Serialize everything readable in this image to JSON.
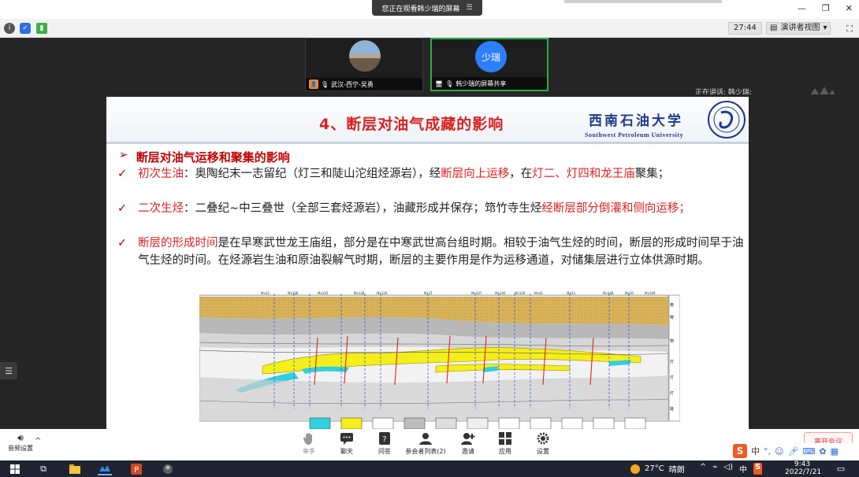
{
  "window": {
    "sharing_banner": "您正在观看韩少瑞的屏幕",
    "sharing_menu_icon": "menu-icon"
  },
  "toolbar": {
    "timer": "27:44",
    "presenter_view": "演讲者视图",
    "status_colors": {
      "info": "#555555",
      "shield": "#2d6fe0",
      "signal": "#3cae4a"
    }
  },
  "participants": [
    {
      "name": "武汉-西宁-吴勇",
      "avatar": "landscape-photo"
    },
    {
      "name": "韩少瑞的屏幕共享",
      "avatar_text": "少瑞",
      "avatar_color": "#2d7ff9"
    }
  ],
  "speaking": "正在讲话: 韩少瑞;",
  "slide": {
    "title": "4、断层对油气成藏的影响",
    "university_cn": "西南石油大学",
    "university_en": "Southwest Petroleum University",
    "heading": "断层对油气运移和聚集的影响",
    "bullets": [
      {
        "parts": [
          {
            "t": "初次生油",
            "red": true
          },
          {
            "t": "：奥陶纪末一志留纪（灯三和陡山沱组烃源岩），经",
            "red": false
          },
          {
            "t": "断层向上运移",
            "red": true
          },
          {
            "t": "，在",
            "red": false
          },
          {
            "t": "灯二、灯四和龙王庙",
            "red": true
          },
          {
            "t": "聚集；",
            "red": false
          }
        ]
      },
      {
        "parts": [
          {
            "t": "二次生烃",
            "red": true
          },
          {
            "t": "：二叠纪~中三叠世（全部三套烃源岩），油藏形成并保存；筇竹寺生烃",
            "red": false
          },
          {
            "t": "经断层部分倒灌和侧向运移；",
            "red": true
          }
        ]
      },
      {
        "parts": [
          {
            "t": "断层的形成时间",
            "red": true
          },
          {
            "t": "是在早寒武世龙王庙组，部分是在中寒武世高台组时期。相较于油气生烃的时间，断层的形成时间早于油气生烃的时间。在烃源岩生油和原油裂解气时期，断层的主要作用是作为运移通道，对储集层进行立体供源时期。",
            "red": false
          }
        ]
      }
    ],
    "figure_wells": [
      "Mx22",
      "Mx108",
      "Mx105",
      "Mx128",
      "Mx126",
      "Mx11",
      "Mx107",
      "Mx146",
      "Mx129",
      "Mx41",
      "Mx23",
      "Mx148",
      "Mx39",
      "Mx149"
    ],
    "figure_legend": [
      "奥陶",
      "寒武",
      "筇竹寺",
      "灯四",
      "灯三",
      "灯二",
      "陡山沱"
    ]
  },
  "meeting_bar": {
    "audio": "音频设置",
    "items": [
      {
        "label": "举手",
        "icon": "hand-icon",
        "dim": true
      },
      {
        "label": "聊天",
        "icon": "chat-icon",
        "dim": false
      },
      {
        "label": "问答",
        "icon": "qa-icon",
        "dim": false
      },
      {
        "label": "参会者列表(2)",
        "icon": "participants-icon",
        "dim": false
      },
      {
        "label": "邀请",
        "icon": "invite-icon",
        "dim": false
      },
      {
        "label": "应用",
        "icon": "apps-icon",
        "dim": false
      },
      {
        "label": "设置",
        "icon": "settings-icon",
        "dim": false
      }
    ],
    "leave": "离开会议"
  },
  "ime": {
    "lang": "中"
  },
  "taskbar": {
    "temperature": "27°C",
    "weather": "晴朗",
    "ime_lang": "中",
    "time": "9:43",
    "date": "2022/7/21"
  }
}
